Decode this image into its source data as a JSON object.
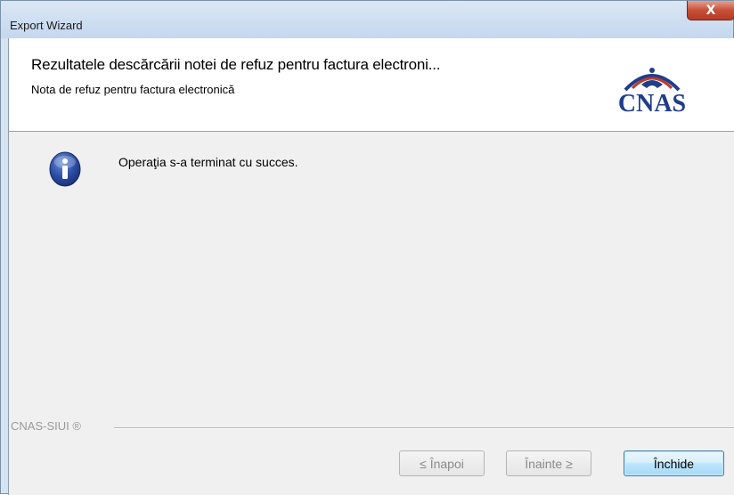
{
  "window": {
    "title": "Export Wizard",
    "close_glyph": "X"
  },
  "header": {
    "title": "Rezultatele descărcării notei de refuz pentru factura electroni...",
    "subtitle": "Nota de refuz pentru factura electronică",
    "logo_text": "CNAS"
  },
  "body": {
    "icon": "info-icon",
    "message": "Operaţia s-a terminat cu succes."
  },
  "footer": {
    "brand": "CNAS-SIUI ®",
    "back_label": "≤ Înapoi",
    "next_label": "Înainte ≥",
    "close_label": "Închide"
  },
  "colors": {
    "accent": "#3c7fb1",
    "logo": "#1f3d8a",
    "logo_arc": "#c0392b"
  }
}
